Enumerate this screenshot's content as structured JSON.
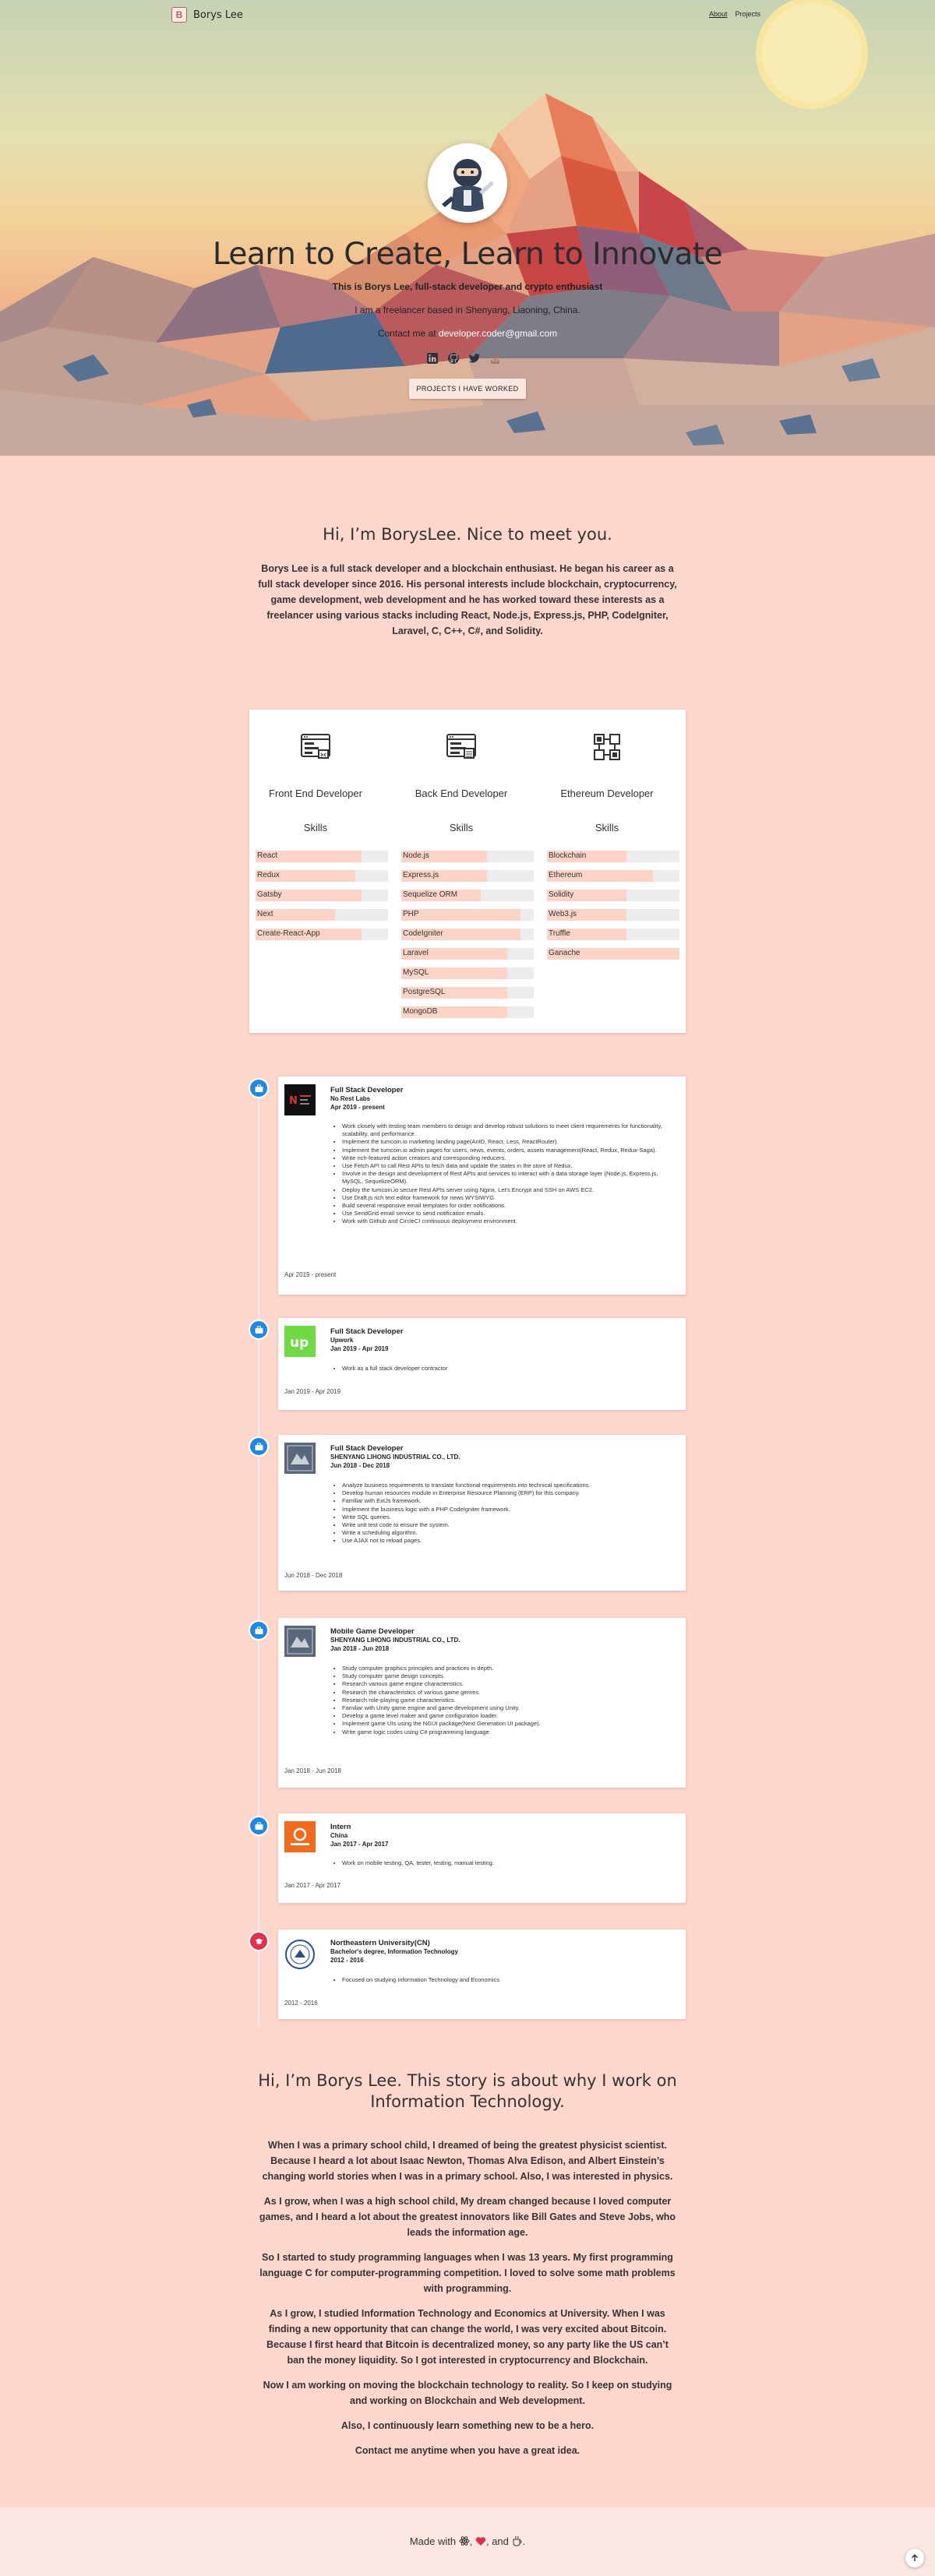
{
  "nav": {
    "brand": "Borys Lee",
    "brand_mark": "B",
    "links": [
      {
        "label": "About",
        "active": true
      },
      {
        "label": "Projects",
        "active": false
      }
    ]
  },
  "hero": {
    "title": "Learn to Create, Learn to Innovate",
    "subtitle": "This is Borys Lee, full-stack developer and crypto enthusiast",
    "location": "I am a freelancer based in Shenyang, Liaoning, China.",
    "contact_prefix": "Contact me at ",
    "email": "developer.coder@gmail.com",
    "social_icons": [
      "linkedin-icon",
      "github-icon",
      "twitter-icon",
      "stackoverflow-icon"
    ],
    "button": "PROJECTS I HAVE WORKED"
  },
  "intro": {
    "heading": "Hi, I’m BorysLee. Nice to meet you.",
    "text": "Borys Lee is a full stack developer and a blockchain enthusiast. He began his career as a full stack developer since 2016. His personal interests include blockchain, cryptocurrency, game development, web development and he has worked toward these interests as a freelancer using various stacks including React, Node.js, Express.js, PHP, CodeIgniter, Laravel, C, C++, C#, and Solidity."
  },
  "skills": {
    "skills_label": "Skills",
    "columns": [
      {
        "title": "Front End Developer",
        "icon": "frontend-code-icon",
        "items": [
          {
            "name": "React",
            "level": 0.8
          },
          {
            "name": "Redux",
            "level": 0.75
          },
          {
            "name": "Gatsby",
            "level": 0.8
          },
          {
            "name": "Next",
            "level": 0.6
          },
          {
            "name": "Create-React-App",
            "level": 0.8
          }
        ]
      },
      {
        "title": "Back End Developer",
        "icon": "backend-code-icon",
        "items": [
          {
            "name": "Node.js",
            "level": 0.65
          },
          {
            "name": "Express.js",
            "level": 0.65
          },
          {
            "name": "Sequelize ORM",
            "level": 0.6
          },
          {
            "name": "PHP",
            "level": 0.9
          },
          {
            "name": "CodeIgniter",
            "level": 0.9
          },
          {
            "name": "Laravel",
            "level": 0.8
          },
          {
            "name": "MySQL",
            "level": 0.8
          },
          {
            "name": "PostgreSQL",
            "level": 0.8
          },
          {
            "name": "MongoDB",
            "level": 0.8
          }
        ]
      },
      {
        "title": "Ethereum Developer",
        "icon": "ethereum-blocks-icon",
        "items": [
          {
            "name": "Blockchain",
            "level": 0.6
          },
          {
            "name": "Ethereum",
            "level": 0.8
          },
          {
            "name": "Solidity",
            "level": 0.6
          },
          {
            "name": "Web3.js",
            "level": 0.6
          },
          {
            "name": "Truffle",
            "level": 0.6
          },
          {
            "name": "Ganache",
            "level": 1.0
          }
        ]
      }
    ]
  },
  "experience": [
    {
      "type": "work",
      "title": "Full Stack Developer",
      "company": "No Rest Labs",
      "dates": "Apr 2019 - present",
      "footer_date": "Apr 2019 - present",
      "logo": "no-rest-labs-logo",
      "items": [
        "Work closely with testing team members to design and develop robust solutions to meet client requirements for functionality, scalability, and performance.",
        "Implement the tumcoin.io marketing landing page(AntD, React, Less, ReactRouter).",
        "Implement the tumcoin.io admin pages for users, news, events, orders, assets management(React, Redux, Redux-Saga).",
        "Write rich-featured action creators and corresponding reducers.",
        "Use Fetch API to call Rest APIs to fetch data and update the states in the store of Redux.",
        "Involve in the design and development of Rest APIs and services to interact with a data storage layer (Node.js, Express.js, MySQL, SequelizeORM).",
        "Deploy the tumcoin.io secure Rest APIs server using Nginx, Let's Encrypt and SSH on AWS EC2.",
        "Use Draft.js rich text editor framework for news WYSIWYG.",
        "Build several responsive email templates for order notifications.",
        "Use SendGrid email service to send notification emails.",
        "Work with Github and CircleCI continuous deployment environment."
      ]
    },
    {
      "type": "work",
      "title": "Full Stack Developer",
      "company": "Upwork",
      "dates": "Jan 2019 - Apr 2019",
      "footer_date": "Jan 2019 - Apr 2019",
      "logo": "upwork-logo",
      "items": [
        "Work as a full stack developer contractor"
      ]
    },
    {
      "type": "work",
      "title": "Full Stack Developer",
      "company": "SHENYANG LIHONG INDUSTRIAL CO., LTD.",
      "dates": "Jun 2018 - Dec 2018",
      "footer_date": "Jun 2018 - Dec 2018",
      "logo": "lihong-logo",
      "items": [
        "Analyze business requirements to translate functional requirements into technical specifications.",
        "Develop human resources module in Enterprise Resource Planning (ERP) for this company.",
        "Familiar with ExtJs framework.",
        "Implement the business logic with a PHP CodeIgniter framework.",
        "Write SQL queries.",
        "Write unit test code to ensure the system.",
        "Write a scheduling algorithm.",
        "Use AJAX not to reload pages."
      ]
    },
    {
      "type": "work",
      "title": "Mobile Game Developer",
      "company": "SHENYANG LIHONG INDUSTRIAL CO., LTD.",
      "dates": "Jan 2018 - Jun 2018",
      "footer_date": "Jan 2018 - Jun 2018",
      "logo": "lihong-logo",
      "items": [
        "Study computer graphics principles and practices in depth.",
        "Study computer game design concepts.",
        "Research various game engine characteristics.",
        "Research the characteristics of various game genres.",
        "Research role-playing game characteristics.",
        "Familiar with Unity game engine and game development using Unity.",
        "Develop a game level maker and game configuration loader.",
        "Implement game UIs using the NGUI package(Next Generation UI package).",
        "Write game logic codes using C# programming language."
      ]
    },
    {
      "type": "work",
      "title": "Intern",
      "company": "China",
      "dates": "Jan 2017 - Apr 2017",
      "footer_date": "Jan 2017 - Apr 2017",
      "logo": "intern-company-logo",
      "items": [
        "Work on mobile testing, QA, tester, testing, manual testing."
      ]
    },
    {
      "type": "education",
      "title": "Northeastern University(CN)",
      "company": "Bachelor's degree, Information Technology",
      "dates": "2012 - 2016",
      "footer_date": "2012 - 2016",
      "logo": "university-seal-logo",
      "items": [
        "Focused on studying Information Technology and Economics"
      ]
    }
  ],
  "story": {
    "heading_line1": "Hi, I’m Borys Lee. This story is about why I work on",
    "heading_line2": "Information Technology.",
    "paragraphs": [
      "When I was a primary school child, I dreamed of being the greatest physicist scientist. Because I heard a lot about Isaac Newton, Thomas Alva Edison, and Albert Einstein’s changing world stories when I was in a primary school. Also, I was interested in physics.",
      "As I grow, when I was a high school child, My dream changed because I loved computer games, and I heard a lot about the greatest innovators like Bill Gates and Steve Jobs, who leads the information age.",
      "So I started to study programming languages when I was 13 years. My first programming language C for computer-programming competition. I loved to solve some math problems with programming.",
      "As I grow, I studied Information Technology and Economics at University. When I was finding a new opportunity that can change the world, I was very excited about Bitcoin. Because I first heard that Bitcoin is decentralized money, so any party like the US can’t ban the money liquidity. So I got interested in cryptocurrency and Blockchain.",
      "Now I am working on moving the blockchain technology to reality. So I keep on studying and working on Blockchain and Web development.",
      "Also, I continuously learn something new to be a hero.",
      "Contact me anytime when you have a great idea."
    ]
  },
  "footer": {
    "made_with": "Made with",
    "and": ", and",
    "end": "."
  },
  "colors": {
    "page_bg": "#fdd7cc",
    "bar_fill": "#fcd4c7",
    "bar_track": "#ececec",
    "timeline_work": "#1e88e5",
    "timeline_edu": "#e5304f"
  }
}
